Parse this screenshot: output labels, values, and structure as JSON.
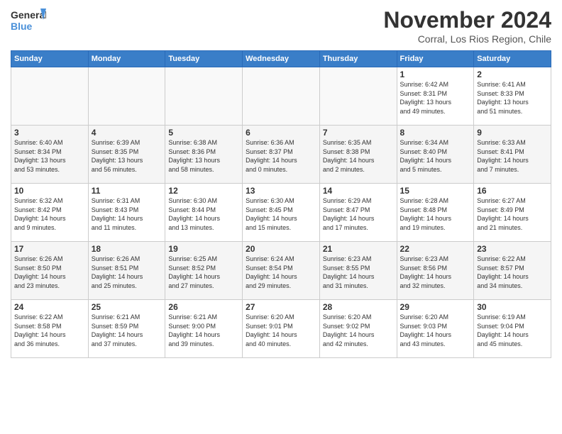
{
  "header": {
    "logo_line1": "General",
    "logo_line2": "Blue",
    "month_title": "November 2024",
    "location": "Corral, Los Rios Region, Chile"
  },
  "days_of_week": [
    "Sunday",
    "Monday",
    "Tuesday",
    "Wednesday",
    "Thursday",
    "Friday",
    "Saturday"
  ],
  "weeks": [
    [
      {
        "day": "",
        "info": ""
      },
      {
        "day": "",
        "info": ""
      },
      {
        "day": "",
        "info": ""
      },
      {
        "day": "",
        "info": ""
      },
      {
        "day": "",
        "info": ""
      },
      {
        "day": "1",
        "info": "Sunrise: 6:42 AM\nSunset: 8:31 PM\nDaylight: 13 hours\nand 49 minutes."
      },
      {
        "day": "2",
        "info": "Sunrise: 6:41 AM\nSunset: 8:33 PM\nDaylight: 13 hours\nand 51 minutes."
      }
    ],
    [
      {
        "day": "3",
        "info": "Sunrise: 6:40 AM\nSunset: 8:34 PM\nDaylight: 13 hours\nand 53 minutes."
      },
      {
        "day": "4",
        "info": "Sunrise: 6:39 AM\nSunset: 8:35 PM\nDaylight: 13 hours\nand 56 minutes."
      },
      {
        "day": "5",
        "info": "Sunrise: 6:38 AM\nSunset: 8:36 PM\nDaylight: 13 hours\nand 58 minutes."
      },
      {
        "day": "6",
        "info": "Sunrise: 6:36 AM\nSunset: 8:37 PM\nDaylight: 14 hours\nand 0 minutes."
      },
      {
        "day": "7",
        "info": "Sunrise: 6:35 AM\nSunset: 8:38 PM\nDaylight: 14 hours\nand 2 minutes."
      },
      {
        "day": "8",
        "info": "Sunrise: 6:34 AM\nSunset: 8:40 PM\nDaylight: 14 hours\nand 5 minutes."
      },
      {
        "day": "9",
        "info": "Sunrise: 6:33 AM\nSunset: 8:41 PM\nDaylight: 14 hours\nand 7 minutes."
      }
    ],
    [
      {
        "day": "10",
        "info": "Sunrise: 6:32 AM\nSunset: 8:42 PM\nDaylight: 14 hours\nand 9 minutes."
      },
      {
        "day": "11",
        "info": "Sunrise: 6:31 AM\nSunset: 8:43 PM\nDaylight: 14 hours\nand 11 minutes."
      },
      {
        "day": "12",
        "info": "Sunrise: 6:30 AM\nSunset: 8:44 PM\nDaylight: 14 hours\nand 13 minutes."
      },
      {
        "day": "13",
        "info": "Sunrise: 6:30 AM\nSunset: 8:45 PM\nDaylight: 14 hours\nand 15 minutes."
      },
      {
        "day": "14",
        "info": "Sunrise: 6:29 AM\nSunset: 8:47 PM\nDaylight: 14 hours\nand 17 minutes."
      },
      {
        "day": "15",
        "info": "Sunrise: 6:28 AM\nSunset: 8:48 PM\nDaylight: 14 hours\nand 19 minutes."
      },
      {
        "day": "16",
        "info": "Sunrise: 6:27 AM\nSunset: 8:49 PM\nDaylight: 14 hours\nand 21 minutes."
      }
    ],
    [
      {
        "day": "17",
        "info": "Sunrise: 6:26 AM\nSunset: 8:50 PM\nDaylight: 14 hours\nand 23 minutes."
      },
      {
        "day": "18",
        "info": "Sunrise: 6:26 AM\nSunset: 8:51 PM\nDaylight: 14 hours\nand 25 minutes."
      },
      {
        "day": "19",
        "info": "Sunrise: 6:25 AM\nSunset: 8:52 PM\nDaylight: 14 hours\nand 27 minutes."
      },
      {
        "day": "20",
        "info": "Sunrise: 6:24 AM\nSunset: 8:54 PM\nDaylight: 14 hours\nand 29 minutes."
      },
      {
        "day": "21",
        "info": "Sunrise: 6:23 AM\nSunset: 8:55 PM\nDaylight: 14 hours\nand 31 minutes."
      },
      {
        "day": "22",
        "info": "Sunrise: 6:23 AM\nSunset: 8:56 PM\nDaylight: 14 hours\nand 32 minutes."
      },
      {
        "day": "23",
        "info": "Sunrise: 6:22 AM\nSunset: 8:57 PM\nDaylight: 14 hours\nand 34 minutes."
      }
    ],
    [
      {
        "day": "24",
        "info": "Sunrise: 6:22 AM\nSunset: 8:58 PM\nDaylight: 14 hours\nand 36 minutes."
      },
      {
        "day": "25",
        "info": "Sunrise: 6:21 AM\nSunset: 8:59 PM\nDaylight: 14 hours\nand 37 minutes."
      },
      {
        "day": "26",
        "info": "Sunrise: 6:21 AM\nSunset: 9:00 PM\nDaylight: 14 hours\nand 39 minutes."
      },
      {
        "day": "27",
        "info": "Sunrise: 6:20 AM\nSunset: 9:01 PM\nDaylight: 14 hours\nand 40 minutes."
      },
      {
        "day": "28",
        "info": "Sunrise: 6:20 AM\nSunset: 9:02 PM\nDaylight: 14 hours\nand 42 minutes."
      },
      {
        "day": "29",
        "info": "Sunrise: 6:20 AM\nSunset: 9:03 PM\nDaylight: 14 hours\nand 43 minutes."
      },
      {
        "day": "30",
        "info": "Sunrise: 6:19 AM\nSunset: 9:04 PM\nDaylight: 14 hours\nand 45 minutes."
      }
    ]
  ]
}
